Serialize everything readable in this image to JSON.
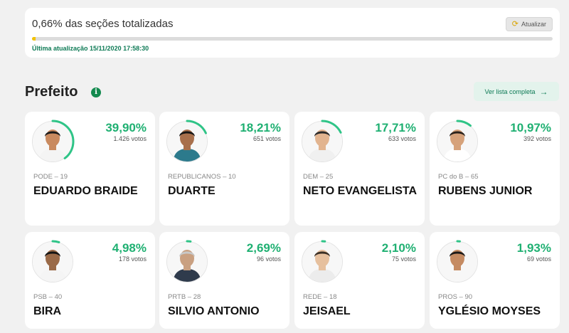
{
  "progress": {
    "title": "0,66% das seções totalizadas",
    "refresh_label": "Atualizar",
    "percent": 0.66,
    "updated": "Última atualização 15/11/2020 17:58:30",
    "bar_color": "#f2c200"
  },
  "section": {
    "title": "Prefeito",
    "info_icon": "i",
    "full_list_label": "Ver lista completa",
    "full_list_arrow": "→"
  },
  "candidates": [
    {
      "name": "EDUARDO BRAIDE",
      "party": "PODE – 19",
      "pct": "39,90%",
      "pct_value": 39.9,
      "votes": "1.426 votos"
    },
    {
      "name": "DUARTE",
      "party": "REPUBLICANOS – 10",
      "pct": "18,21%",
      "pct_value": 18.21,
      "votes": "651 votos"
    },
    {
      "name": "NETO EVANGELISTA",
      "party": "DEM – 25",
      "pct": "17,71%",
      "pct_value": 17.71,
      "votes": "633 votos"
    },
    {
      "name": "RUBENS JUNIOR",
      "party": "PC do B – 65",
      "pct": "10,97%",
      "pct_value": 10.97,
      "votes": "392 votos"
    },
    {
      "name": "BIRA",
      "party": "PSB – 40",
      "pct": "4,98%",
      "pct_value": 4.98,
      "votes": "178 votos"
    },
    {
      "name": "SILVIO ANTONIO",
      "party": "PRTB – 28",
      "pct": "2,69%",
      "pct_value": 2.69,
      "votes": "96 votos"
    },
    {
      "name": "JEISAEL",
      "party": "REDE – 18",
      "pct": "2,10%",
      "pct_value": 2.1,
      "votes": "75 votos"
    },
    {
      "name": "YGLÉSIO MOYSES",
      "party": "PROS – 90",
      "pct": "1,93%",
      "pct_value": 1.93,
      "votes": "69 votos"
    }
  ],
  "colors": {
    "accent": "#1fb072",
    "ring": "#2fc487",
    "updated_text": "#0d7a55"
  }
}
